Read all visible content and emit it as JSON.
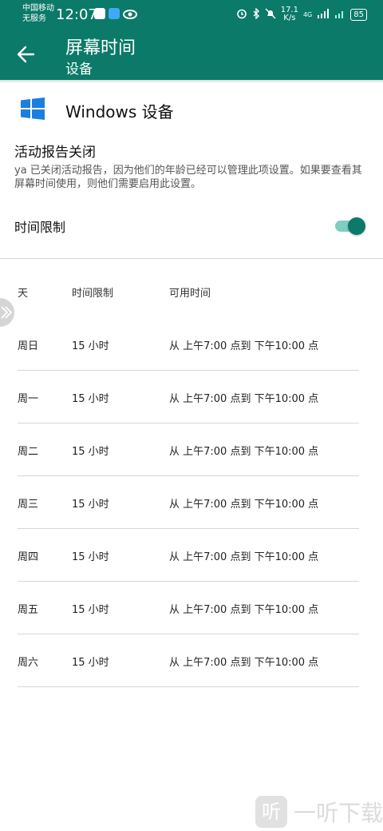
{
  "status_bar": {
    "carrier_line1": "中国移动",
    "carrier_line2": "无服务",
    "time": "12:07",
    "network_speed_top": "17.1",
    "network_speed_bottom": "K/s",
    "network_type": "4G",
    "battery": "85",
    "icons": [
      "message-icon",
      "cloud-icon",
      "eye-icon",
      "alarm-icon",
      "bluetooth-icon",
      "mute-icon",
      "signal-icon",
      "wifi-icon"
    ],
    "color": "#0b7a68"
  },
  "app_bar": {
    "title": "屏幕时间",
    "subtitle": "设备",
    "color": "#0b7a68"
  },
  "device": {
    "name": "Windows 设备",
    "icon": "windows-logo-icon",
    "icon_color": "#1a7fe0"
  },
  "activity_report": {
    "title": "活动报告关闭",
    "description": "ya 已关闭活动报告，因为他们的年龄已经可以管理此项设置。如果要查看其屏幕时间使用，则他们需要启用此设置。"
  },
  "time_limit": {
    "label": "时间限制",
    "enabled": true
  },
  "schedule": {
    "headers": [
      "天",
      "时间限制",
      "可用时间"
    ],
    "rows": [
      {
        "day": "周日",
        "limit": "15 小时",
        "available": "从 上午7:00 点到 下午10:00 点"
      },
      {
        "day": "周一",
        "limit": "15 小时",
        "available": "从 上午7:00 点到 下午10:00 点"
      },
      {
        "day": "周二",
        "limit": "15 小时",
        "available": "从 上午7:00 点到 下午10:00 点"
      },
      {
        "day": "周三",
        "limit": "15 小时",
        "available": "从 上午7:00 点到 下午10:00 点"
      },
      {
        "day": "周四",
        "limit": "15 小时",
        "available": "从 上午7:00 点到 下午10:00 点"
      },
      {
        "day": "周五",
        "limit": "15 小时",
        "available": "从 上午7:00 点到 下午10:00 点"
      },
      {
        "day": "周六",
        "limit": "15 小时",
        "available": "从 上午7:00 点到 下午10:00 点"
      }
    ]
  },
  "watermark": {
    "glyph": "听",
    "text": "一听下载"
  }
}
